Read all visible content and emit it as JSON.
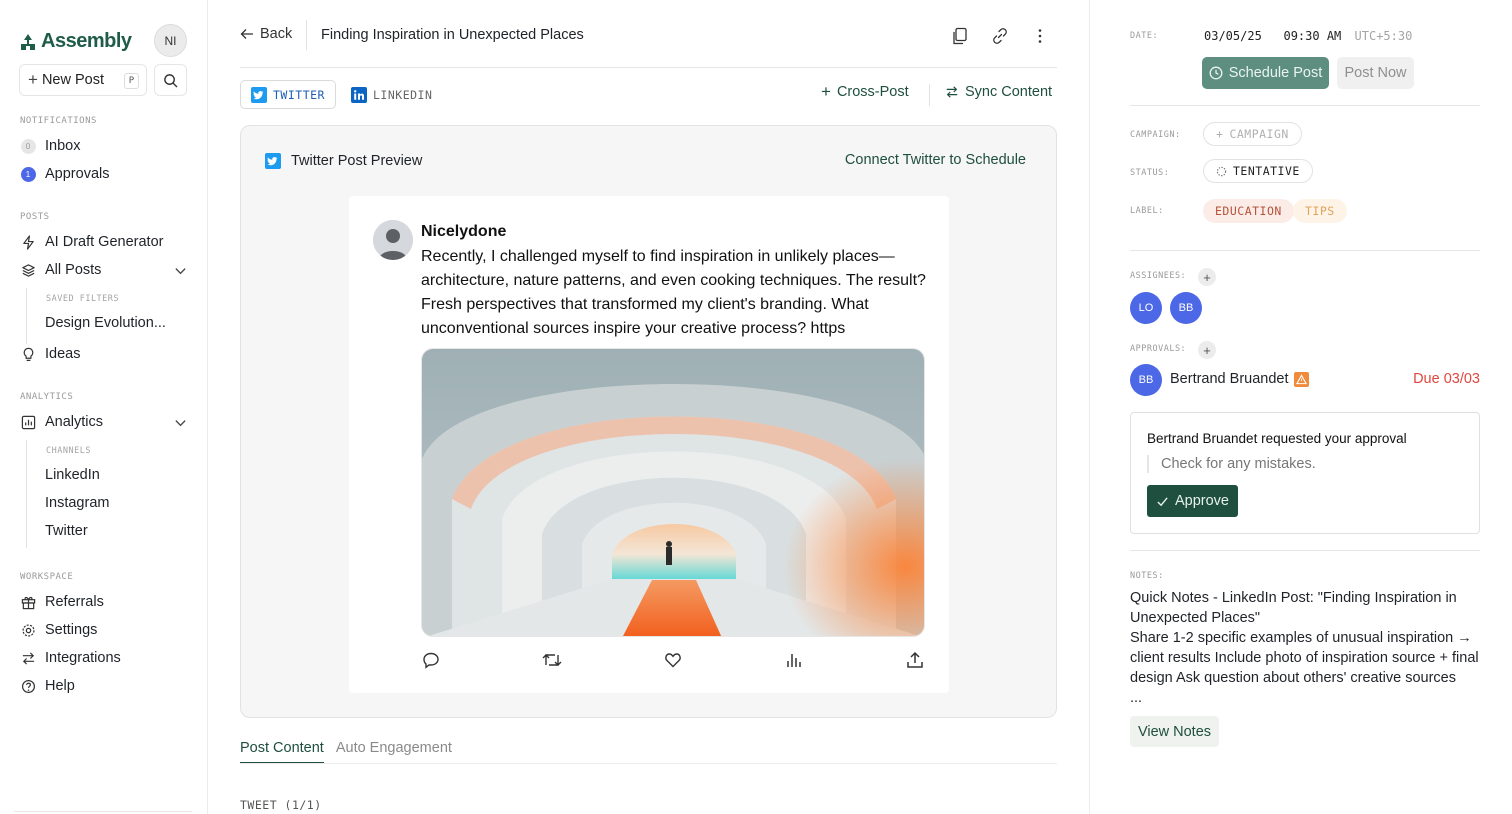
{
  "sidebar": {
    "brand": "Assembly",
    "user_initials": "NI",
    "new_post_label": "New Post",
    "new_post_shortcut": "P",
    "sections": {
      "notifications": "NOTIFICATIONS",
      "posts": "POSTS",
      "analytics": "ANALYTICS",
      "workspace": "WORKSPACE"
    },
    "notifications": [
      {
        "label": "Inbox",
        "badge": "0"
      },
      {
        "label": "Approvals",
        "badge": "1"
      }
    ],
    "posts": {
      "ai_draft": "AI Draft Generator",
      "all_posts": "All Posts",
      "saved_filters_label": "SAVED FILTERS",
      "saved_filters": [
        "Design Evolution..."
      ],
      "ideas": "Ideas"
    },
    "analytics": {
      "label": "Analytics",
      "channels_label": "CHANNELS",
      "channels": [
        "LinkedIn",
        "Instagram",
        "Twitter"
      ]
    },
    "workspace": [
      "Referrals",
      "Settings",
      "Integrations",
      "Help"
    ]
  },
  "header": {
    "back_label": "Back",
    "title": "Finding Inspiration in Unexpected Places"
  },
  "channels": {
    "tabs": [
      {
        "label": "TWITTER",
        "active": true
      },
      {
        "label": "LINKEDIN",
        "active": false
      }
    ],
    "cross_post": "Cross-Post",
    "sync_content": "Sync Content"
  },
  "preview": {
    "heading": "Twitter Post Preview",
    "connect_label": "Connect Twitter to Schedule",
    "author": "Nicelydone",
    "text": "Recently, I challenged myself to find inspiration in unlikely places—architecture, nature patterns, and even cooking techniques. The result? Fresh perspectives that transformed my client's branding. What unconventional sources inspire your creative process? https",
    "actions": [
      "reply-icon",
      "retweet-icon",
      "like-icon",
      "stats-icon",
      "share-icon"
    ]
  },
  "bottom_tabs": {
    "tabs": [
      {
        "label": "Post Content",
        "active": true
      },
      {
        "label": "Auto Engagement",
        "active": false
      }
    ],
    "tweet_counter": "TWEET (1/1)"
  },
  "details": {
    "date_label": "DATE:",
    "date": "03/05/25",
    "time": "09:30 AM",
    "timezone": "UTC+5:30",
    "schedule_label": "Schedule Post",
    "post_now_label": "Post Now",
    "campaign_label": "CAMPAIGN:",
    "campaign_placeholder": "CAMPAIGN",
    "status_label": "STATUS:",
    "status": "TENTATIVE",
    "label_label": "LABEL:",
    "labels": [
      "EDUCATION",
      "TIPS"
    ],
    "assignees_label": "ASSIGNEES:",
    "assignees": [
      "LO",
      "BB"
    ],
    "approvals_label": "APPROVALS:",
    "approver_initials": "BB",
    "approver_name": "Bertrand Bruandet",
    "due": "Due 03/03",
    "approval_request": "Bertrand Bruandet requested your approval",
    "approval_note": "Check for any mistakes.",
    "approve_label": "Approve",
    "notes_label": "NOTES:",
    "notes_lines": [
      "Quick Notes - LinkedIn Post: \"Finding Inspiration in Unexpected Places\"",
      "Share 1-2 specific examples of unusual inspiration → client results Include photo of inspiration source + final design Ask question about others' creative sources",
      "..."
    ],
    "view_notes_label": "View Notes"
  },
  "colors": {
    "brand": "#1f5c49",
    "accent_dark": "#1f4f3e",
    "schedule_bg": "#5e8e7f",
    "avatar_blue": "#4c68e6",
    "due_red": "#e0473e",
    "education_bg": "#fbece8",
    "tips_bg": "#fdf3e6"
  }
}
